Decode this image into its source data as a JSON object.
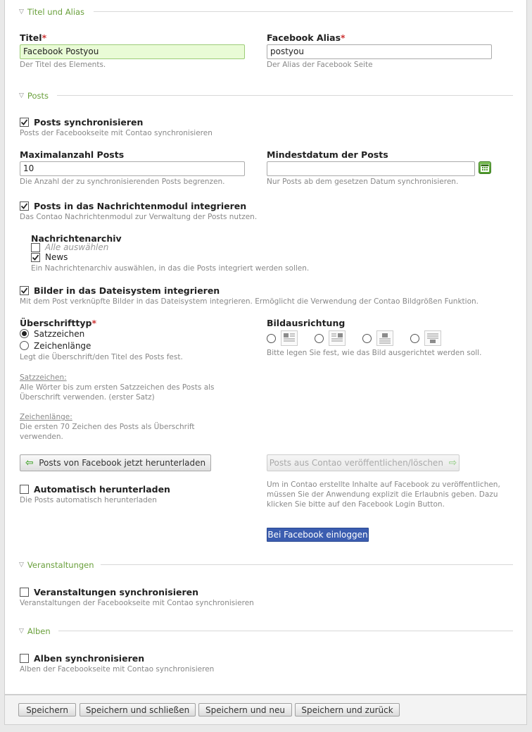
{
  "sections": {
    "titel_alias": "Titel und Alias",
    "posts": "Posts",
    "veranstaltungen": "Veranstaltungen",
    "alben": "Alben"
  },
  "titel": {
    "label": "Titel",
    "required_mark": "*",
    "value": "Facebook Postyou",
    "help": "Der Titel des Elements."
  },
  "alias": {
    "label": "Facebook Alias",
    "required_mark": "*",
    "value": "postyou",
    "help": "Der Alias der Facebook Seite"
  },
  "posts_sync": {
    "label": "Posts synchronisieren",
    "checked": true,
    "help": "Posts der Facebookseite mit Contao synchronisieren"
  },
  "max_posts": {
    "label": "Maximalanzahl Posts",
    "value": "10",
    "help": "Die Anzahl der zu synchronisierenden Posts begrenzen."
  },
  "min_date": {
    "label": "Mindestdatum der Posts",
    "value": "",
    "help": "Nur Posts ab dem gesetzen Datum synchronisieren.",
    "icon": "calendar-icon"
  },
  "news_integrate": {
    "label": "Posts in das Nachrichtenmodul integrieren",
    "checked": true,
    "help": "Das Contao Nachrichtenmodul zur Verwaltung der Posts nutzen."
  },
  "news_archive": {
    "label": "Nachrichtenarchiv",
    "select_all": "Alle auswählen",
    "select_all_checked": false,
    "item": "News",
    "item_checked": true,
    "help": "Ein Nachrichtenarchiv auswählen, in das die Posts integriert werden sollen."
  },
  "images_integrate": {
    "label": "Bilder in das Dateisystem integrieren",
    "checked": true,
    "help": "Mit dem Post verknüpfte Bilder in das Dateisystem integrieren. Ermöglicht die Verwendung der Contao Bildgrößen Funktion."
  },
  "heading_type": {
    "label": "Überschrifttyp",
    "required_mark": "*",
    "options": [
      "Satzzeichen",
      "Zeichenlänge"
    ],
    "selected": "Satzzeichen",
    "help": "Legt die Überschrift/den Titel des Posts fest.",
    "note1_title": "Satzzeichen:",
    "note1_text": "Alle Wörter bis zum ersten Satzzeichen des Posts als Überschrift verwenden. (erster Satz)",
    "note2_title": "Zeichenlänge:",
    "note2_text": "Die ersten 70 Zeichen des Posts als Überschrift verwenden."
  },
  "image_align": {
    "label": "Bildausrichtung",
    "help": "Bitte legen Sie fest, wie das Bild ausgerichtet werden soll.",
    "icons": [
      "align-left-icon",
      "align-right-icon",
      "align-top-icon",
      "align-bottom-icon"
    ]
  },
  "download_button": "Posts von Facebook jetzt herunterladen",
  "publish_button": "Posts aus Contao veröffentlichen/löschen",
  "auto_download": {
    "label": "Automatisch herunterladen",
    "checked": false,
    "help": "Die Posts automatisch herunterladen"
  },
  "fb_login": {
    "text": "Um in Contao erstellte Inhalte auf Facebook zu veröffentlichen, müssen Sie der Anwendung explizit die Erlaubnis geben. Dazu klicken Sie bitte auf den Facebook Login Button.",
    "button": "Bei Facebook einloggen"
  },
  "events_sync": {
    "label": "Veranstaltungen synchronisieren",
    "checked": false,
    "help": "Veranstaltungen der Facebookseite mit Contao synchronisieren"
  },
  "albums_sync": {
    "label": "Alben synchronisieren",
    "checked": false,
    "help": "Alben der Facebookseite mit Contao synchronisieren"
  },
  "footer": {
    "save": "Speichern",
    "save_close": "Speichern und schließen",
    "save_new": "Speichern und neu",
    "save_back": "Speichern und zurück"
  }
}
